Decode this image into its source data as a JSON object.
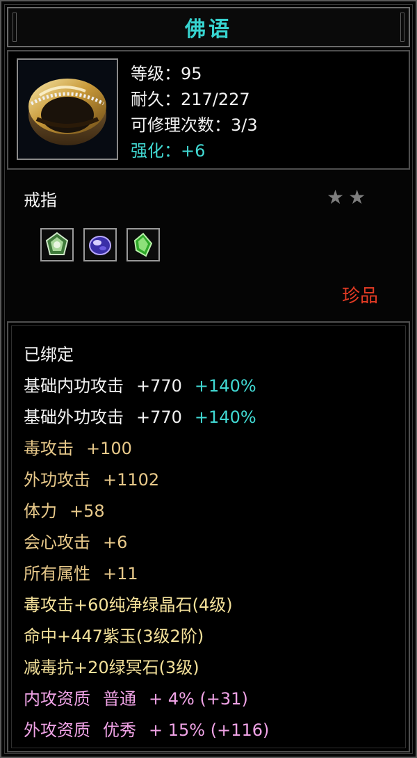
{
  "title": "佛语",
  "header": {
    "level": "等级：95",
    "durability": "耐久：217/227",
    "repairs": "可修理次数：3/3",
    "enhance": "强化：+6",
    "item_icon": "ring-icon"
  },
  "item_type": "戒指",
  "stars": {
    "count": 2,
    "icon": "star-icon"
  },
  "gems": [
    {
      "name": "green-white-gem-icon"
    },
    {
      "name": "blue-purple-gem-icon"
    },
    {
      "name": "green-crystal-gem-icon"
    }
  ],
  "rarity": "珍品",
  "colors": {
    "title": "#37d3cf",
    "rarity": "#e23b24",
    "bound": "#f2f2f2",
    "base": "#f2f2f2",
    "bonus": "#e8c98a",
    "socket": "#f4e19a",
    "percent": "#41d9d3",
    "aptitude": "#f0a3e6"
  },
  "attributes": {
    "bound": "已绑定",
    "base1": {
      "label": "基础内功攻击",
      "value": "+770",
      "pct": "+140%"
    },
    "base2": {
      "label": "基础外功攻击",
      "value": "+770",
      "pct": "+140%"
    },
    "bonus": [
      {
        "label": "毒攻击",
        "value": "+100"
      },
      {
        "label": "外功攻击",
        "value": "+1102"
      },
      {
        "label": "体力",
        "value": "+58"
      },
      {
        "label": "会心攻击",
        "value": "+6"
      },
      {
        "label": "所有属性",
        "value": "+11"
      }
    ],
    "sockets": [
      "毒攻击+60纯净绿晶石(4级)",
      "命中+447紫玉(3级2阶)",
      "减毒抗+20绿冥石(3级)"
    ],
    "aptitudes": [
      {
        "label": "内攻资质",
        "grade": "普通",
        "rest": "+ 4% (+31)"
      },
      {
        "label": "外攻资质",
        "grade": "优秀",
        "rest": "+ 15% (+116)"
      }
    ]
  }
}
